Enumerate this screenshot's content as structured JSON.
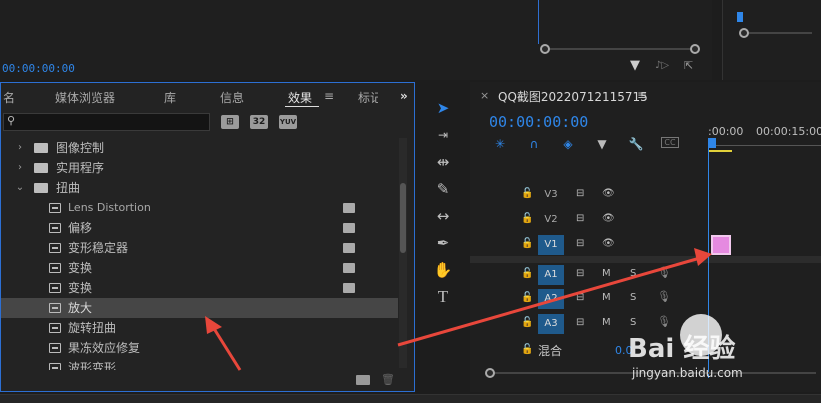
{
  "top": {
    "timecode": "00:00:00:00"
  },
  "effects_panel": {
    "tabs": [
      {
        "label": "名"
      },
      {
        "label": "媒体浏览器"
      },
      {
        "label": "库"
      },
      {
        "label": "信息"
      },
      {
        "label": "效果"
      },
      {
        "label": "≡"
      },
      {
        "label": "标记"
      },
      {
        "label": "»"
      }
    ],
    "search": {
      "value": "",
      "placeholder": ""
    },
    "filter_buttons": [
      "⊞",
      "32",
      "YUV"
    ],
    "tree": [
      {
        "type": "folder",
        "label": "图像控制",
        "expanded": false
      },
      {
        "type": "folder",
        "label": "实用程序",
        "expanded": false
      },
      {
        "type": "folder",
        "label": "扭曲",
        "expanded": true
      },
      {
        "type": "effect",
        "label": "Lens Distortion",
        "accelerated": true
      },
      {
        "type": "effect",
        "label": "偏移",
        "accelerated": true
      },
      {
        "type": "effect",
        "label": "变形稳定器",
        "accelerated": true
      },
      {
        "type": "effect",
        "label": "变换",
        "accelerated": true
      },
      {
        "type": "effect",
        "label": "变换",
        "accelerated": true
      },
      {
        "type": "effect",
        "label": "放大",
        "selected": true
      },
      {
        "type": "effect",
        "label": "旋转扭曲"
      },
      {
        "type": "effect",
        "label": "果冻效应修复"
      },
      {
        "type": "effect",
        "label": "波形变形"
      }
    ]
  },
  "tools": [
    "selection-tool",
    "track-select-tool",
    "ripple-edit-tool",
    "razor-tool",
    "slip-tool",
    "pen-tool",
    "hand-tool",
    "type-tool"
  ],
  "timeline": {
    "close": "×",
    "sequence_name": "QQ截图20220712115715",
    "menu": "≡",
    "timecode": "00:00:00:00",
    "ruler": [
      ":00:00",
      "00:00:15:00"
    ],
    "video_tracks": [
      {
        "name": "V3",
        "active": false
      },
      {
        "name": "V2",
        "active": false
      },
      {
        "name": "V1",
        "active": true
      }
    ],
    "audio_tracks": [
      {
        "name": "A1",
        "active": true,
        "m": "M",
        "s": "S"
      },
      {
        "name": "A2",
        "active": true,
        "m": "M",
        "s": "S"
      },
      {
        "name": "A3",
        "active": true,
        "m": "M",
        "s": "S"
      }
    ],
    "master": {
      "label": "混合",
      "value": "0.0"
    }
  },
  "watermark": {
    "brand": "Bai 经验",
    "url": "jingyan.baidu.com"
  },
  "colors": {
    "accent": "#2f86e8",
    "clip": "#e58ae0",
    "arrow": "#e8473b"
  }
}
